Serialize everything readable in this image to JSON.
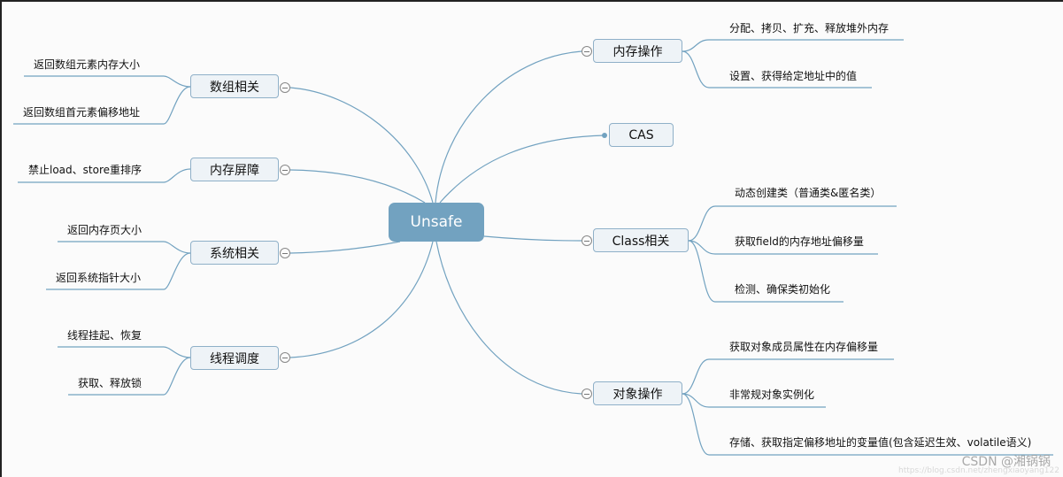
{
  "center": {
    "label": "Unsafe"
  },
  "branches": [
    {
      "id": "array",
      "label": "数组相关",
      "side": "left",
      "children": [
        "返回数组元素内存大小",
        "返回数组首元素偏移地址"
      ]
    },
    {
      "id": "barrier",
      "label": "内存屏障",
      "side": "left",
      "children": [
        "禁止load、store重排序"
      ]
    },
    {
      "id": "system",
      "label": "系统相关",
      "side": "left",
      "children": [
        "返回内存页大小",
        "返回系统指针大小"
      ]
    },
    {
      "id": "thread",
      "label": "线程调度",
      "side": "left",
      "children": [
        "线程挂起、恢复",
        "获取、释放锁"
      ]
    },
    {
      "id": "memory",
      "label": "内存操作",
      "side": "right",
      "children": [
        "分配、拷贝、扩充、释放堆外内存",
        "设置、获得给定地址中的值"
      ]
    },
    {
      "id": "cas",
      "label": "CAS",
      "side": "right",
      "children": []
    },
    {
      "id": "class",
      "label": "Class相关",
      "side": "right",
      "children": [
        "动态创建类（普通类&匿名类）",
        "获取field的内存地址偏移量",
        "检测、确保类初始化"
      ]
    },
    {
      "id": "object",
      "label": "对象操作",
      "side": "right",
      "children": [
        "获取对象成员属性在内存偏移量",
        "非常规对象实例化",
        "存储、获取指定偏移地址的变量值(包含延迟生效、volatile语义)"
      ]
    }
  ],
  "colors": {
    "line": "#72a2c0",
    "center": "#72a2c0",
    "node_bg": "#eef3f7",
    "node_border": "#8fb0c8"
  },
  "watermark": {
    "text": "CSDN @湘锅锅",
    "url": "https://blog.csdn.net/zhengxiaoyang122"
  }
}
